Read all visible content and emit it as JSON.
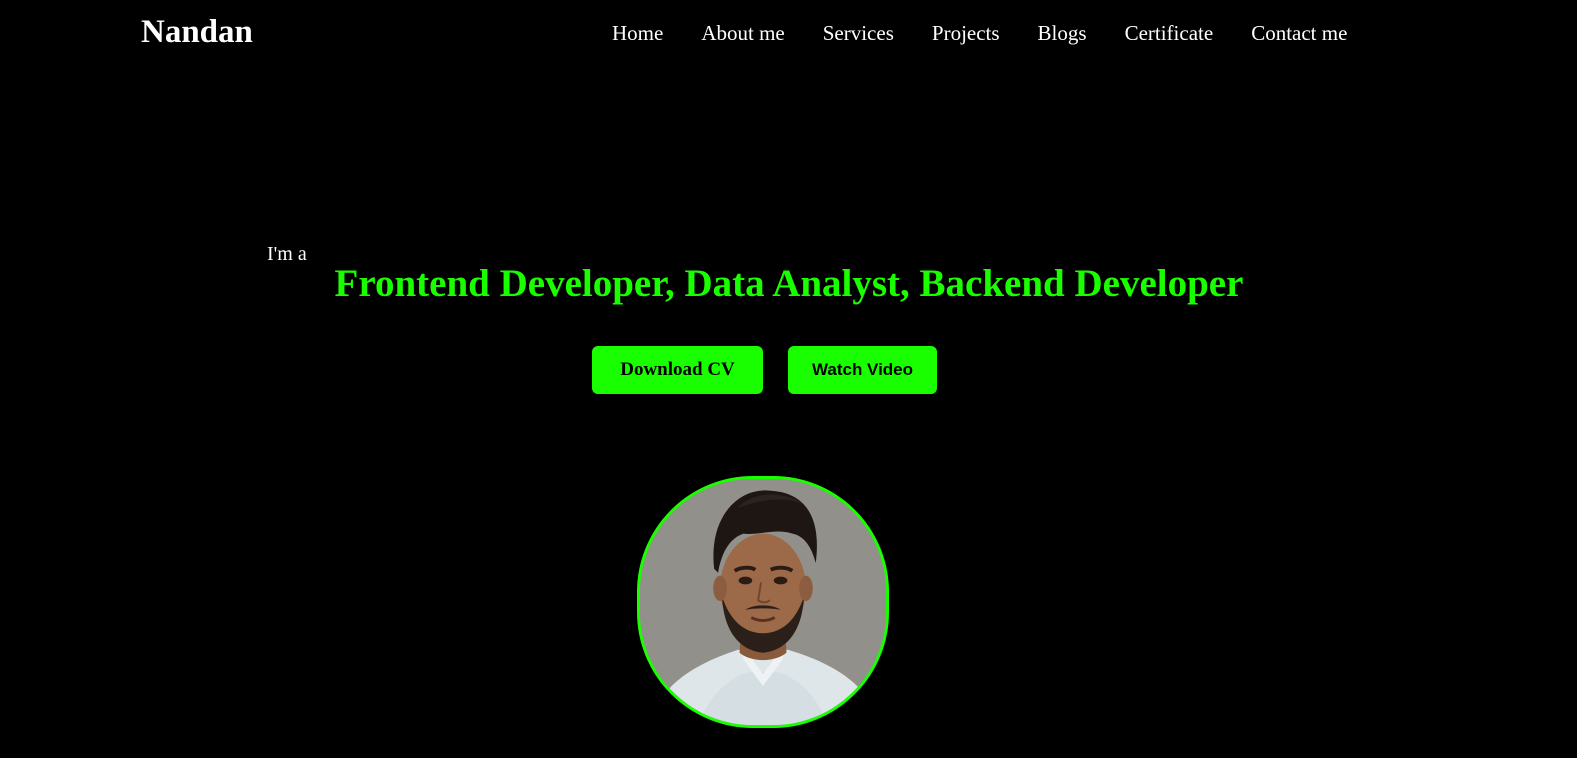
{
  "brand": {
    "name": "Nandan"
  },
  "nav": {
    "items": [
      {
        "label": "Home"
      },
      {
        "label": "About me"
      },
      {
        "label": "Services"
      },
      {
        "label": "Projects"
      },
      {
        "label": "Blogs"
      },
      {
        "label": "Certificate"
      },
      {
        "label": "Contact me"
      }
    ]
  },
  "hero": {
    "intro": "I'm a",
    "roles": "Frontend Developer, Data Analyst, Backend Developer",
    "download_cv_label": "Download CV",
    "watch_video_label": "Watch Video",
    "avatar_alt": "Profile photo"
  },
  "colors": {
    "background": "#000000",
    "accent": "#1aff00",
    "text": "#ffffff"
  }
}
